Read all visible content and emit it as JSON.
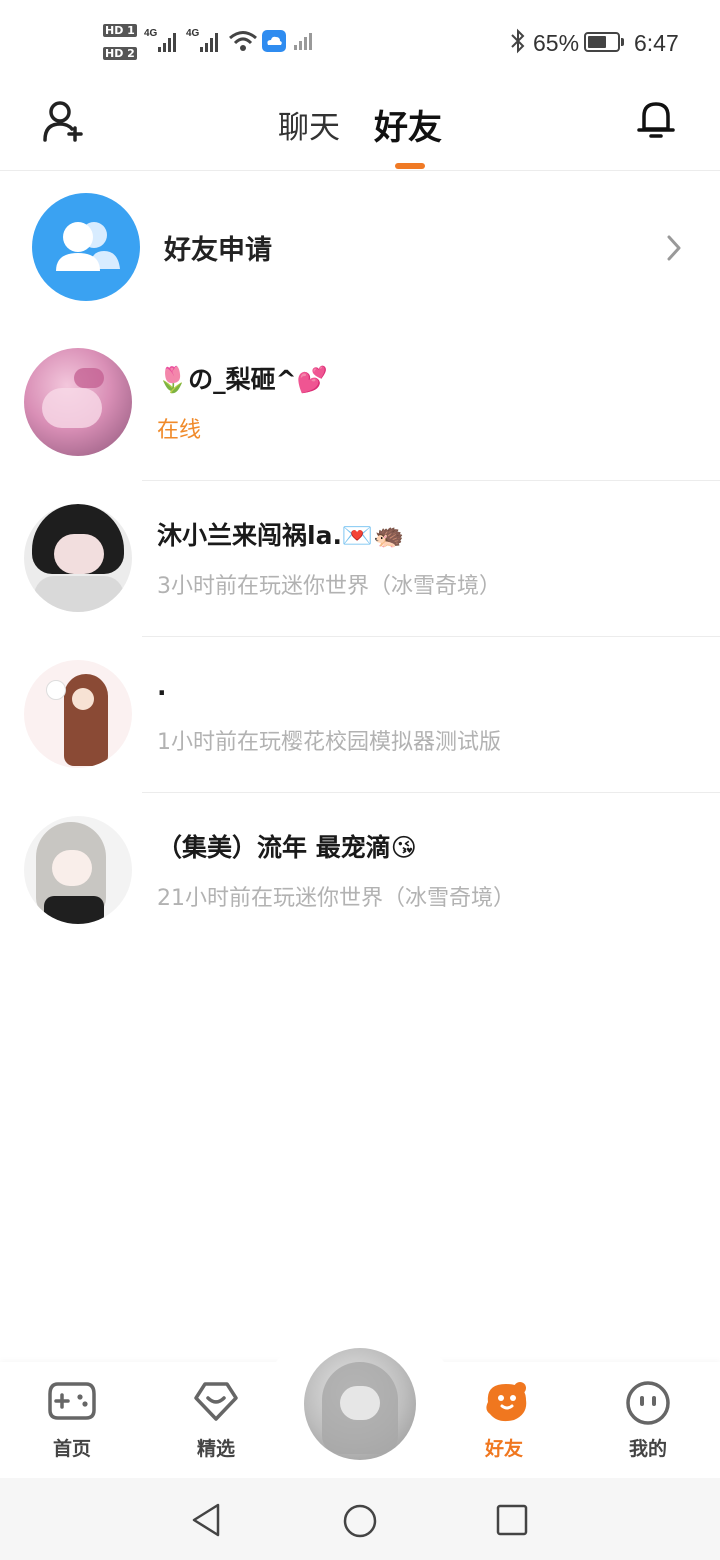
{
  "status_bar": {
    "hd1": "HD 1",
    "hd2": "HD 2",
    "net1": "4G",
    "net2": "4G",
    "bt_icon": "bluetooth-icon",
    "battery_pct": "65%",
    "battery_level": 0.65,
    "time": "6:47"
  },
  "header": {
    "add_friend_icon": "add-person-icon",
    "tab_chat": "聊天",
    "tab_friends": "好友",
    "bell_icon": "bell-icon"
  },
  "friend_request": {
    "label": "好友申请",
    "icon": "people-icon"
  },
  "friends": [
    {
      "name": "🌷の_梨砸^💕",
      "status": "在线",
      "online": true
    },
    {
      "name": "沐小兰来闯祸la.💌🦔",
      "status": "3小时前在玩迷你世界（冰雪奇境）",
      "online": false
    },
    {
      "name": ".",
      "status": "1小时前在玩樱花校园模拟器测试版",
      "online": false
    },
    {
      "name": "（集美）流年  最宠滴😘",
      "status": "21小时前在玩迷你世界（冰雪奇境）",
      "online": false
    }
  ],
  "bottom_nav": {
    "home": "首页",
    "featured": "精选",
    "friends": "好友",
    "mine": "我的"
  },
  "colors": {
    "accent": "#f0771f",
    "online": "#f08a2a",
    "request_blue": "#3aa2f2",
    "muted_text": "#b2b2b2"
  }
}
